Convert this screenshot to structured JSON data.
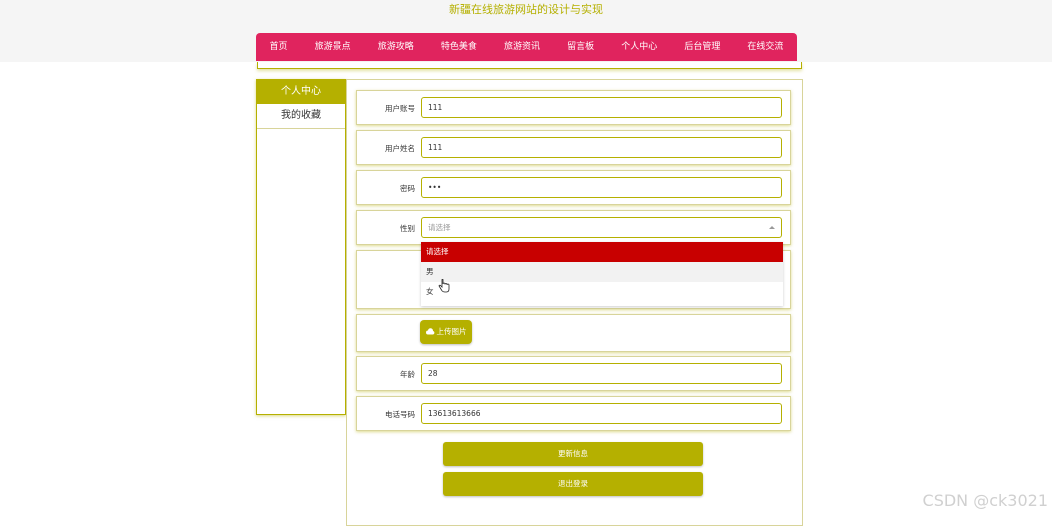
{
  "site": {
    "title": "新疆在线旅游网站的设计与实现"
  },
  "nav": {
    "items": [
      "首页",
      "旅游景点",
      "旅游攻略",
      "特色美食",
      "旅游资讯",
      "留言板",
      "个人中心",
      "后台管理",
      "在线交流"
    ],
    "bg_color": "#e0245e"
  },
  "sidebar": {
    "header": "个人中心",
    "items": [
      "我的收藏"
    ]
  },
  "form": {
    "account": {
      "label": "用户账号",
      "value": "111"
    },
    "name": {
      "label": "用户姓名",
      "value": "111"
    },
    "password": {
      "label": "密码",
      "value": "•••"
    },
    "gender": {
      "label": "性别",
      "placeholder": "请选择",
      "options": [
        "请选择",
        "男",
        "女"
      ]
    },
    "upload_label": "上传图片",
    "age": {
      "label": "年龄",
      "value": "28"
    },
    "phone": {
      "label": "电话号码",
      "value": "13613613666"
    },
    "update_button": "更新信息",
    "logout_button": "退出登录"
  },
  "watermark": "CSDN @ck3021",
  "colors": {
    "accent": "#b5b000",
    "select_highlight": "#c80000"
  }
}
